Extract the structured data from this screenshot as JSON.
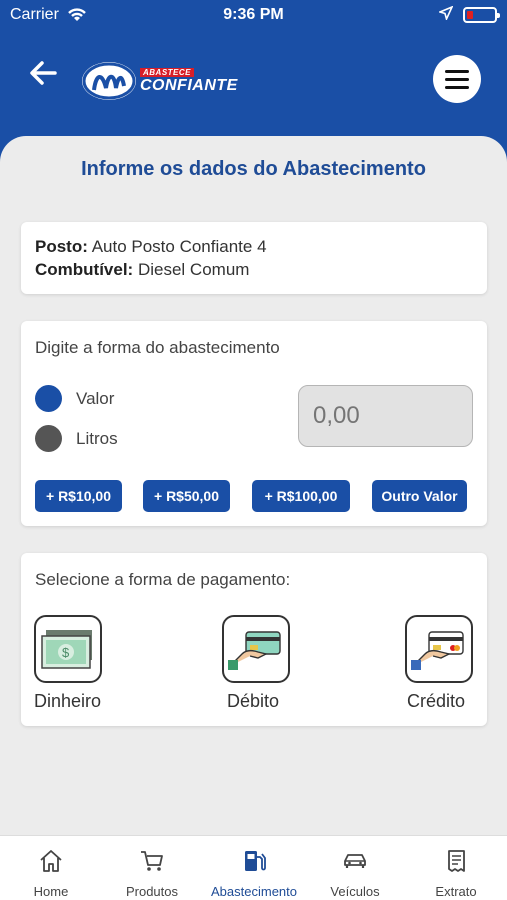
{
  "status_bar": {
    "carrier": "Carrier",
    "time": "9:36 PM"
  },
  "header": {
    "logo_small": "ABASTECE",
    "logo_big": "CONFIANTE"
  },
  "page": {
    "title": "Informe os dados do Abastecimento"
  },
  "station": {
    "posto_label": "Posto:",
    "posto_value": "Auto Posto Confiante 4",
    "combustivel_label": "Combutível:",
    "combustivel_value": "Diesel Comum"
  },
  "fuel_form": {
    "label": "Digite a forma do abastecimento",
    "options": [
      {
        "label": "Valor",
        "selected": true,
        "color": "#1a4fa6"
      },
      {
        "label": "Litros",
        "selected": false,
        "color": "#555555"
      }
    ],
    "amount_placeholder": "0,00",
    "quick_buttons": [
      "+ R$10,00",
      "+ R$50,00",
      "+ R$100,00",
      "Outro Valor"
    ]
  },
  "payment": {
    "label": "Selecione a forma de pagamento:",
    "options": [
      {
        "label": "Dinheiro",
        "icon": "cash-icon"
      },
      {
        "label": "Débito",
        "icon": "debit-card-icon"
      },
      {
        "label": "Crédito",
        "icon": "credit-card-icon"
      }
    ]
  },
  "tabs": [
    {
      "label": "Home",
      "icon": "home-icon",
      "active": false
    },
    {
      "label": "Produtos",
      "icon": "cart-icon",
      "active": false
    },
    {
      "label": "Abastecimento",
      "icon": "fuel-pump-icon",
      "active": true
    },
    {
      "label": "Veículos",
      "icon": "car-icon",
      "active": false
    },
    {
      "label": "Extrato",
      "icon": "receipt-icon",
      "active": false
    }
  ],
  "colors": {
    "primary": "#1a4fa6",
    "title": "#1f4c96",
    "background": "#ececec"
  }
}
